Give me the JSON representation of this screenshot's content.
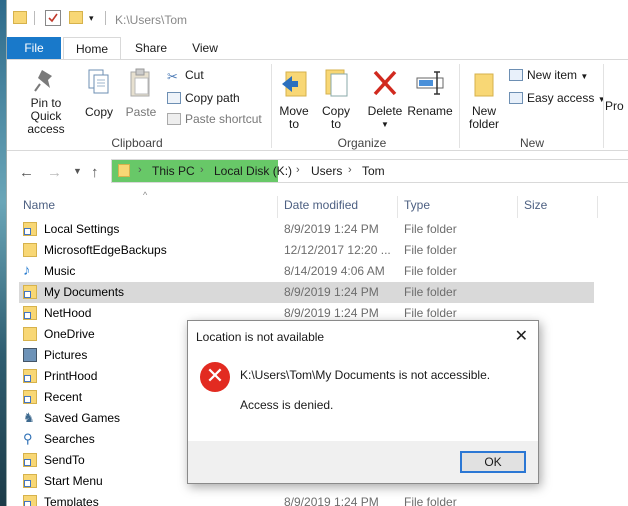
{
  "window": {
    "path_title": "K:\\Users\\Tom"
  },
  "tabs": [
    {
      "label": "File"
    },
    {
      "label": "Home"
    },
    {
      "label": "Share"
    },
    {
      "label": "View"
    }
  ],
  "ribbon": {
    "clipboard": {
      "pin_label": "Pin to Quick access",
      "copy_label": "Copy",
      "paste_label": "Paste",
      "cut_label": "Cut",
      "copy_path_label": "Copy path",
      "paste_shortcut_label": "Paste shortcut",
      "group_label": "Clipboard"
    },
    "organize": {
      "move_label": "Move to",
      "copy_label": "Copy to",
      "delete_label": "Delete",
      "rename_label": "Rename",
      "group_label": "Organize"
    },
    "new": {
      "new_folder_label": "New folder",
      "new_item_label": "New item",
      "easy_access_label": "Easy access",
      "group_label": "New"
    },
    "properties_label": "Pro"
  },
  "address": {
    "crumbs": [
      "This PC",
      "Local Disk (K:)",
      "Users",
      "Tom"
    ]
  },
  "columns": {
    "name": "Name",
    "date": "Date modified",
    "type": "Type",
    "size": "Size"
  },
  "files": [
    {
      "name": "Local Settings",
      "date": "8/9/2019 1:24 PM",
      "type": "File folder",
      "icon": "folder-shortcut"
    },
    {
      "name": "MicrosoftEdgeBackups",
      "date": "12/12/2017 12:20 ...",
      "type": "File folder",
      "icon": "folder"
    },
    {
      "name": "Music",
      "date": "8/14/2019 4:06 AM",
      "type": "File folder",
      "icon": "music"
    },
    {
      "name": "My Documents",
      "date": "8/9/2019 1:24 PM",
      "type": "File folder",
      "icon": "folder-shortcut"
    },
    {
      "name": "NetHood",
      "date": "8/9/2019 1:24 PM",
      "type": "File folder",
      "icon": "folder-shortcut"
    },
    {
      "name": "OneDrive",
      "date": "",
      "type": "",
      "icon": "folder"
    },
    {
      "name": "Pictures",
      "date": "",
      "type": "",
      "icon": "pictures"
    },
    {
      "name": "PrintHood",
      "date": "",
      "type": "",
      "icon": "folder-shortcut"
    },
    {
      "name": "Recent",
      "date": "",
      "type": "",
      "icon": "folder-shortcut"
    },
    {
      "name": "Saved Games",
      "date": "",
      "type": "",
      "icon": "saved-games"
    },
    {
      "name": "Searches",
      "date": "",
      "type": "",
      "icon": "search"
    },
    {
      "name": "SendTo",
      "date": "",
      "type": "",
      "icon": "folder-shortcut"
    },
    {
      "name": "Start Menu",
      "date": "",
      "type": "",
      "icon": "folder-shortcut"
    },
    {
      "name": "Templates",
      "date": "8/9/2019 1:24 PM",
      "type": "File folder",
      "icon": "folder-shortcut"
    }
  ],
  "dialog": {
    "title": "Location is not available",
    "message": "K:\\Users\\Tom\\My Documents is not accessible.",
    "detail": "Access is denied.",
    "ok_label": "OK",
    "close_glyph": "✕",
    "error_glyph": "✕"
  },
  "colors": {
    "file_tab": "#1979ca",
    "selection": "#d9d9d9",
    "address_highlight": "#68c868",
    "error": "#e22b21"
  }
}
